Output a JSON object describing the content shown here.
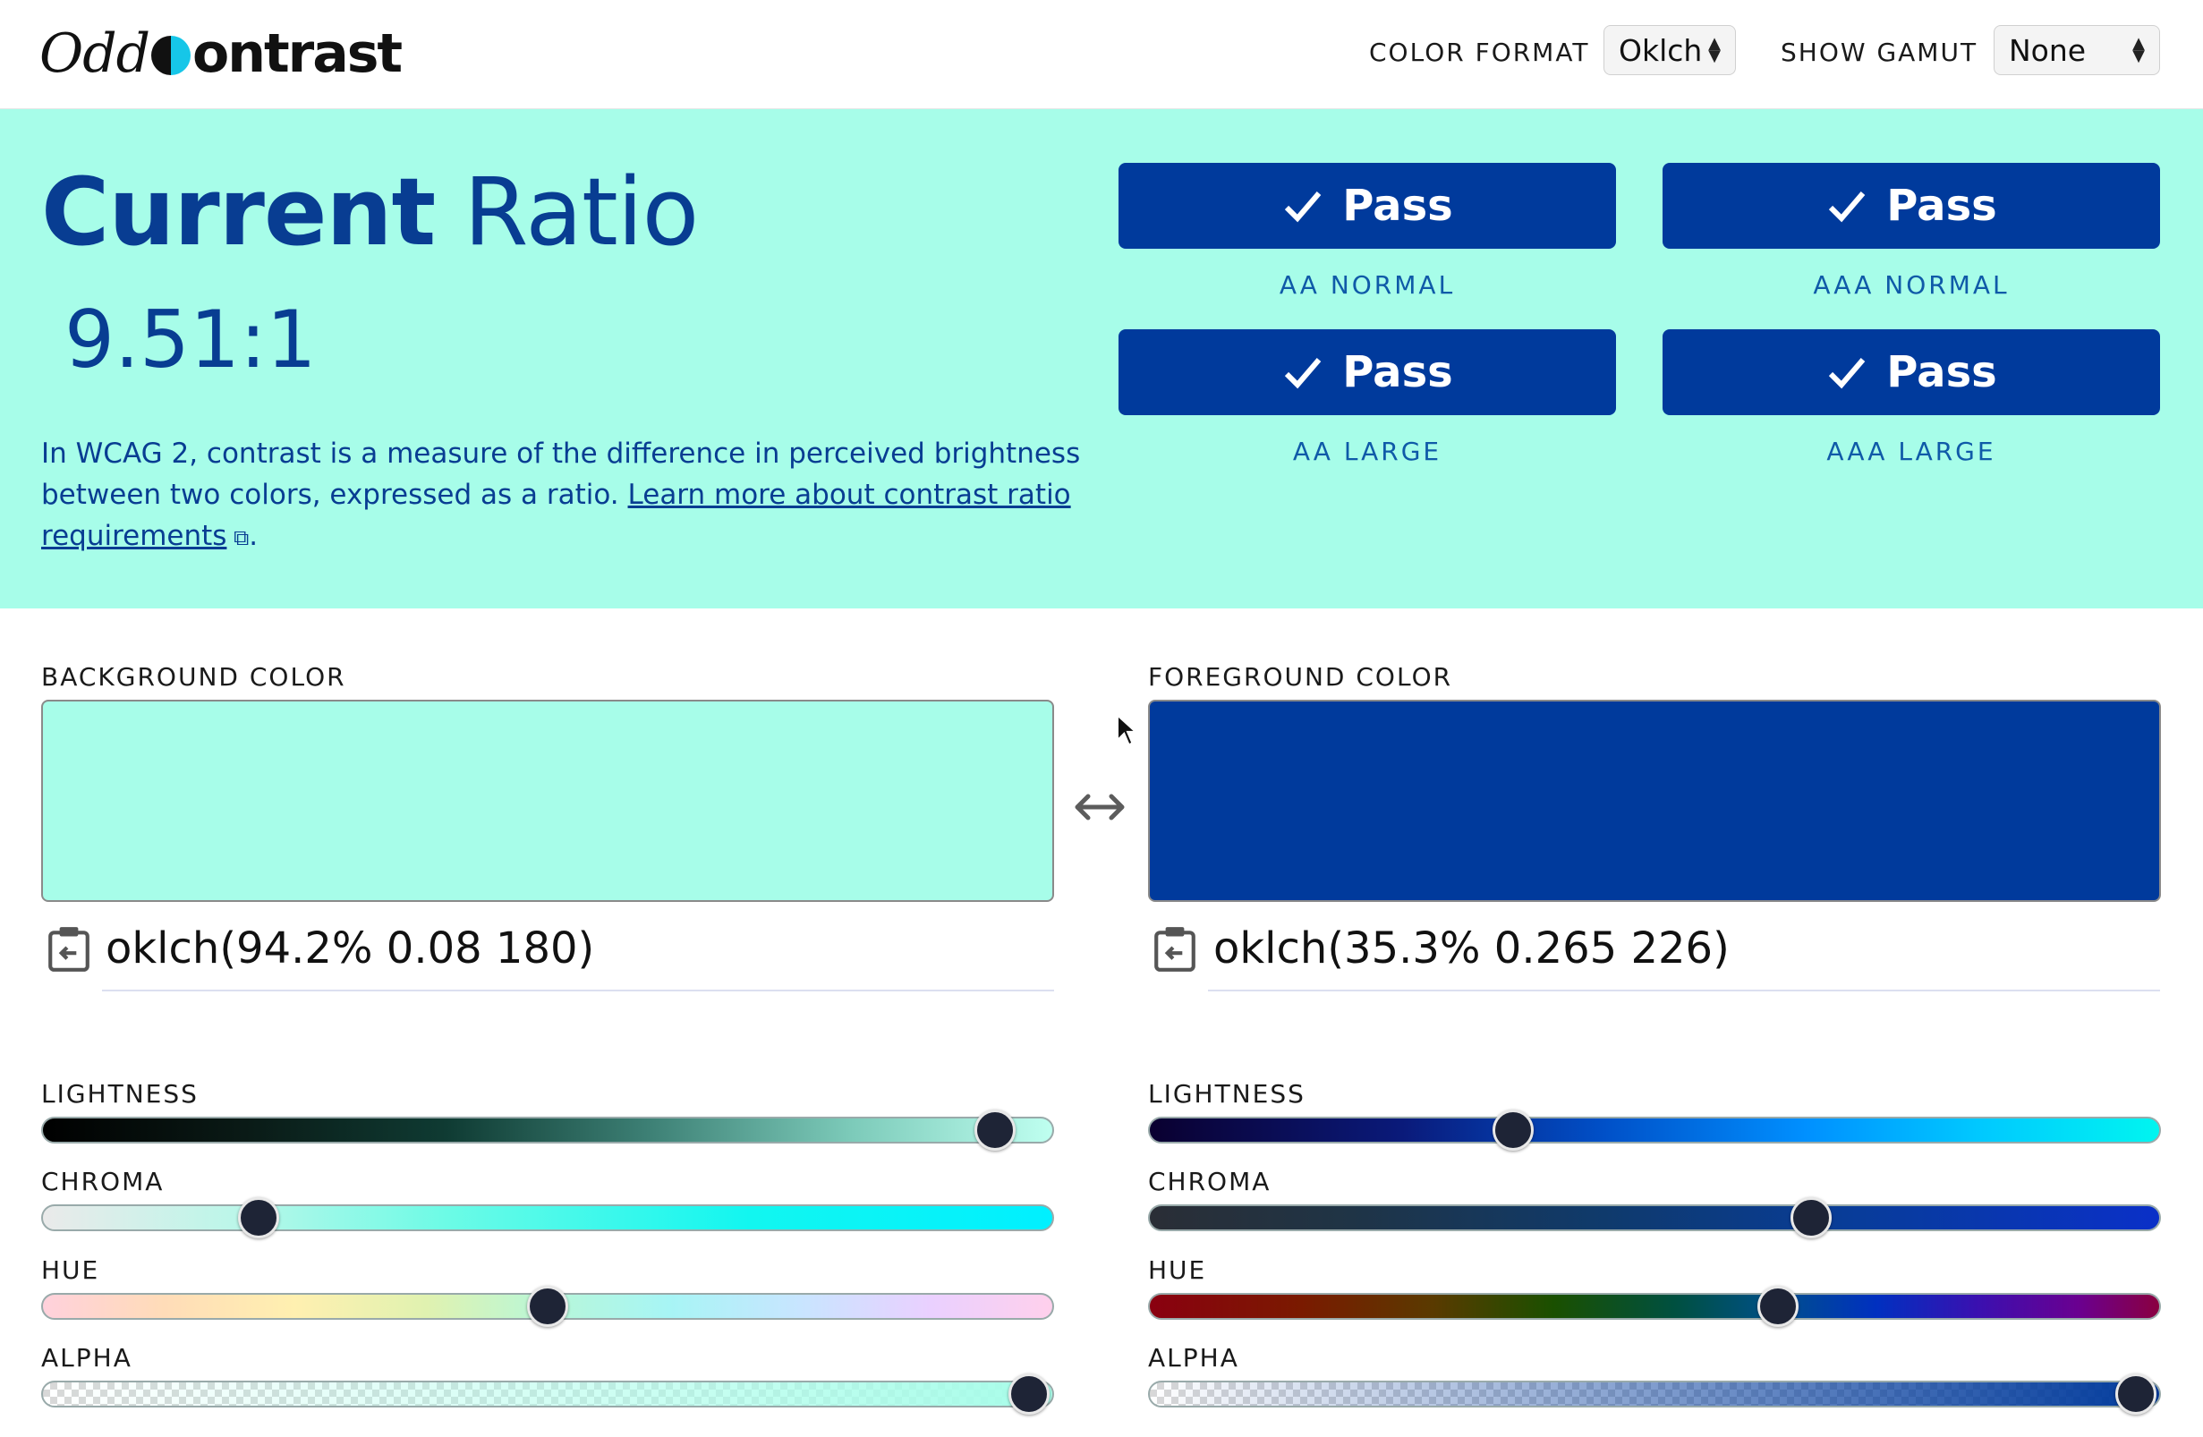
{
  "header": {
    "logo": {
      "odd": "Odd",
      "contrast": "ontrast"
    },
    "color_format_label": "COLOR FORMAT",
    "color_format_value": "Oklch",
    "show_gamut_label": "SHOW GAMUT",
    "show_gamut_value": "None"
  },
  "ratio": {
    "title_bold": "Current",
    "title_light": "Ratio",
    "value": "9.51:1",
    "desc_text": "In WCAG 2, contrast is a measure of the difference in perceived brightness between two colors, expressed as a ratio. ",
    "desc_link": "Learn more about contrast ratio requirements",
    "desc_end": "."
  },
  "checks": [
    {
      "result": "Pass",
      "label": "AA NORMAL"
    },
    {
      "result": "Pass",
      "label": "AAA NORMAL"
    },
    {
      "result": "Pass",
      "label": "AA LARGE"
    },
    {
      "result": "Pass",
      "label": "AAA LARGE"
    }
  ],
  "background": {
    "label": "BACKGROUND COLOR",
    "value": "oklch(94.2% 0.08 180)",
    "color": "#a7fde9",
    "sliders": {
      "lightness": {
        "label": "LIGHTNESS",
        "value": 0.942
      },
      "chroma": {
        "label": "CHROMA",
        "value": 0.215
      },
      "hue": {
        "label": "HUE",
        "value": 0.5
      },
      "alpha": {
        "label": "ALPHA",
        "value": 0.975
      }
    }
  },
  "foreground": {
    "label": "FOREGROUND COLOR",
    "value": "oklch(35.3% 0.265 226)",
    "color": "#003a9c",
    "sliders": {
      "lightness": {
        "label": "LIGHTNESS",
        "value": 0.36
      },
      "chroma": {
        "label": "CHROMA",
        "value": 0.655
      },
      "hue": {
        "label": "HUE",
        "value": 0.622
      },
      "alpha": {
        "label": "ALPHA",
        "value": 0.975
      }
    }
  },
  "colors": {
    "panel_bg": "#a7fde9",
    "button_bg": "#003a9c",
    "heading": "#083d92"
  }
}
